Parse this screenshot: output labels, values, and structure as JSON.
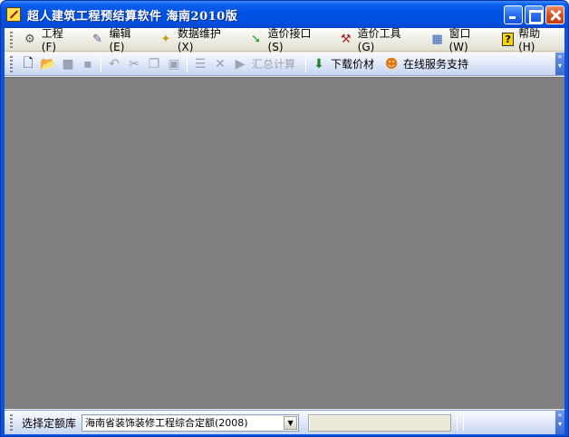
{
  "window": {
    "title": "超人建筑工程预结算软件  海南2010版"
  },
  "menubar": {
    "items": [
      {
        "label": "工程(F)",
        "icon": "project-icon"
      },
      {
        "label": "编辑(E)",
        "icon": "edit-icon"
      },
      {
        "label": "数据维护(X)",
        "icon": "data-maintenance-icon"
      },
      {
        "label": "造价接口(S)",
        "icon": "cost-interface-icon"
      },
      {
        "label": "造价工具(G)",
        "icon": "cost-tools-icon"
      },
      {
        "label": "窗口(W)",
        "icon": "window-icon"
      },
      {
        "label": "帮助(H)",
        "icon": "help-icon"
      }
    ]
  },
  "toolbar": {
    "summary_label": "汇总计算",
    "download_label": "下载价材",
    "online_service_label": "在线服务支持"
  },
  "statusbar": {
    "quota_label": "选择定额库",
    "quota_selected": "海南省装饰装修工程综合定额(2008)"
  },
  "colors": {
    "titlebar": "#0053e5",
    "workspace": "#808080",
    "toolbar": "#dbe4f7"
  }
}
